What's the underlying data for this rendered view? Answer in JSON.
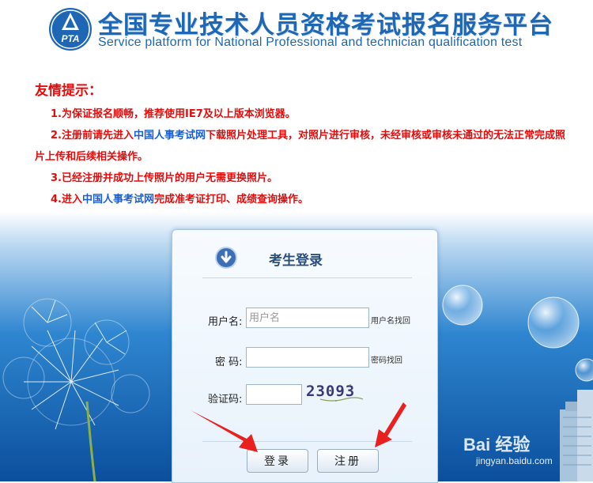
{
  "header": {
    "title_cn": "全国专业技术人员资格考试报名服务平台",
    "title_en": "Service platform for National Professional and technician qualification test",
    "logo_text": "PTA"
  },
  "notice": {
    "title": "友情提示：",
    "line1": "1.为保证报名顺畅，推荐使用IE7及以上版本浏览器。",
    "line2_a": "2.注册前请先进入",
    "line2_link": "中国人事考试网",
    "line2_b": "下载照片处理工具，对照片进行审核，未经审核或审核未通过的无法正常完成照片上传和后续相关操作。",
    "line3": "3.已经注册并成功上传照片的用户无需更换照片。",
    "line4_a": "4.进入",
    "line4_link": "中国人事考试网",
    "line4_b": "完成准考证打印、成绩查询操作。"
  },
  "login": {
    "title": "考生登录",
    "username_label": "用户名:",
    "username_placeholder": "用户名",
    "username_find": "用户名找回",
    "password_label": "密 码:",
    "password_find": "密码找回",
    "captcha_label": "验证码:",
    "captcha_text": "23093",
    "login_button": "登录",
    "register_button": "注册"
  },
  "watermark": {
    "brand": "Bai 经验",
    "url": "jingyan.baidu.com"
  },
  "colors": {
    "title_blue": "#1d67b5",
    "notice_red": "#e50b0b",
    "link_blue": "#1a5fd1",
    "arrow_red": "#e8211f"
  }
}
